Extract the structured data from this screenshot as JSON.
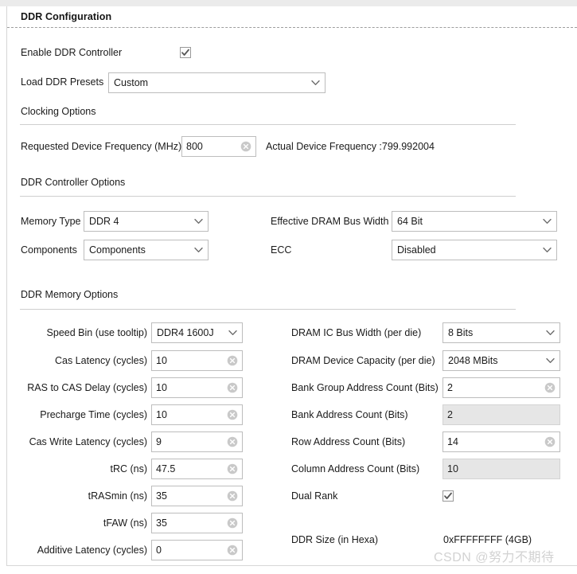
{
  "panel": {
    "title": "DDR Configuration"
  },
  "enable": {
    "label": "Enable DDR Controller",
    "checked": true
  },
  "presets": {
    "label": "Load DDR Presets",
    "value": "Custom"
  },
  "sections": {
    "clocking": "Clocking Options",
    "controller": "DDR Controller Options",
    "memory": "DDR Memory Options"
  },
  "clocking": {
    "requested_label": "Requested Device Frequency (MHz)",
    "requested_value": "800",
    "actual_text": "Actual Device Frequency :799.992004"
  },
  "controller": {
    "memory_type_label": "Memory Type",
    "memory_type_value": "DDR 4",
    "components_label": "Components",
    "components_value": "Components",
    "bus_width_label": "Effective DRAM Bus Width",
    "bus_width_value": "64 Bit",
    "ecc_label": "ECC",
    "ecc_value": "Disabled"
  },
  "memory_left": {
    "speed_bin_label": "Speed Bin (use tooltip)",
    "speed_bin_value": "DDR4 1600J",
    "rows": [
      {
        "label": "Cas Latency (cycles)",
        "value": "10"
      },
      {
        "label": "RAS to CAS Delay (cycles)",
        "value": "10"
      },
      {
        "label": "Precharge Time (cycles)",
        "value": "10"
      },
      {
        "label": "Cas Write Latency (cycles)",
        "value": "9"
      },
      {
        "label": "tRC (ns)",
        "value": "47.5"
      },
      {
        "label": "tRASmin (ns)",
        "value": "35"
      },
      {
        "label": "tFAW (ns)",
        "value": "35"
      },
      {
        "label": "Additive Latency (cycles)",
        "value": "0"
      }
    ]
  },
  "memory_right": {
    "ic_bus_width_label": "DRAM IC Bus Width (per die)",
    "ic_bus_width_value": "8 Bits",
    "device_capacity_label": "DRAM Device Capacity (per die)",
    "device_capacity_value": "2048 MBits",
    "bank_group_label": "Bank Group Address Count (Bits)",
    "bank_group_value": "2",
    "bank_addr_label": "Bank Address Count (Bits)",
    "bank_addr_value": "2",
    "row_addr_label": "Row Address Count (Bits)",
    "row_addr_value": "14",
    "col_addr_label": "Column Address Count (Bits)",
    "col_addr_value": "10",
    "dual_rank_label": "Dual Rank",
    "dual_rank_checked": true,
    "ddr_size_label": "DDR Size (in Hexa)",
    "ddr_size_value": "0xFFFFFFFF (4GB)"
  },
  "watermark": {
    "text": "CSDN @努力不期待"
  },
  "colors": {
    "border": "#bdbdbd",
    "disabled_bg": "#e6e6e6",
    "rule": "#cfcfcf",
    "strip": "#ebebeb",
    "watermark": "#d2d2d2"
  },
  "icons": {
    "clear": "clear-circle-x-icon",
    "chevron": "chevron-down-icon",
    "check": "check-icon"
  }
}
